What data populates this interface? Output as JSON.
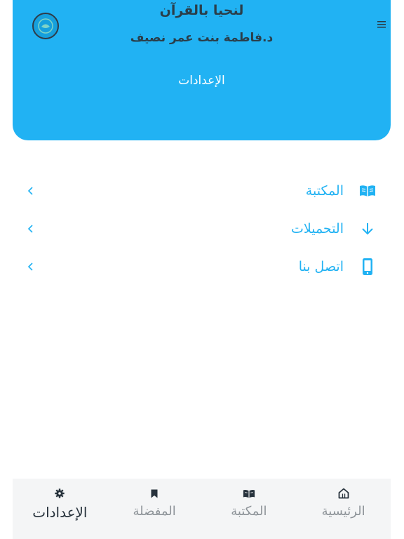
{
  "header": {
    "app_title": "لنحيا بالقرآن",
    "subtitle": "د.فاطمة بنت عمر نصيف",
    "page_title": "الإعدادات",
    "menu_icon": "hamburger-icon",
    "logo": "app-logo"
  },
  "menu": [
    {
      "label": "المكتبة",
      "icon": "book-open-icon"
    },
    {
      "label": "التحميلات",
      "icon": "download-arrow-icon"
    },
    {
      "label": "اتصل بنا",
      "icon": "phone-icon"
    }
  ],
  "bottom_nav": [
    {
      "label": "الإعدادات",
      "icon": "gear-icon",
      "active": true
    },
    {
      "label": "المفضلة",
      "icon": "bookmark-icon",
      "active": false
    },
    {
      "label": "المكتبة",
      "icon": "book-open-icon",
      "active": false
    },
    {
      "label": "الرئيسية",
      "icon": "home-icon",
      "active": false
    }
  ],
  "colors": {
    "primary": "#21b2f3",
    "dark": "#27323c",
    "muted": "#8d9398",
    "nav_bg": "#f4f5f6"
  }
}
